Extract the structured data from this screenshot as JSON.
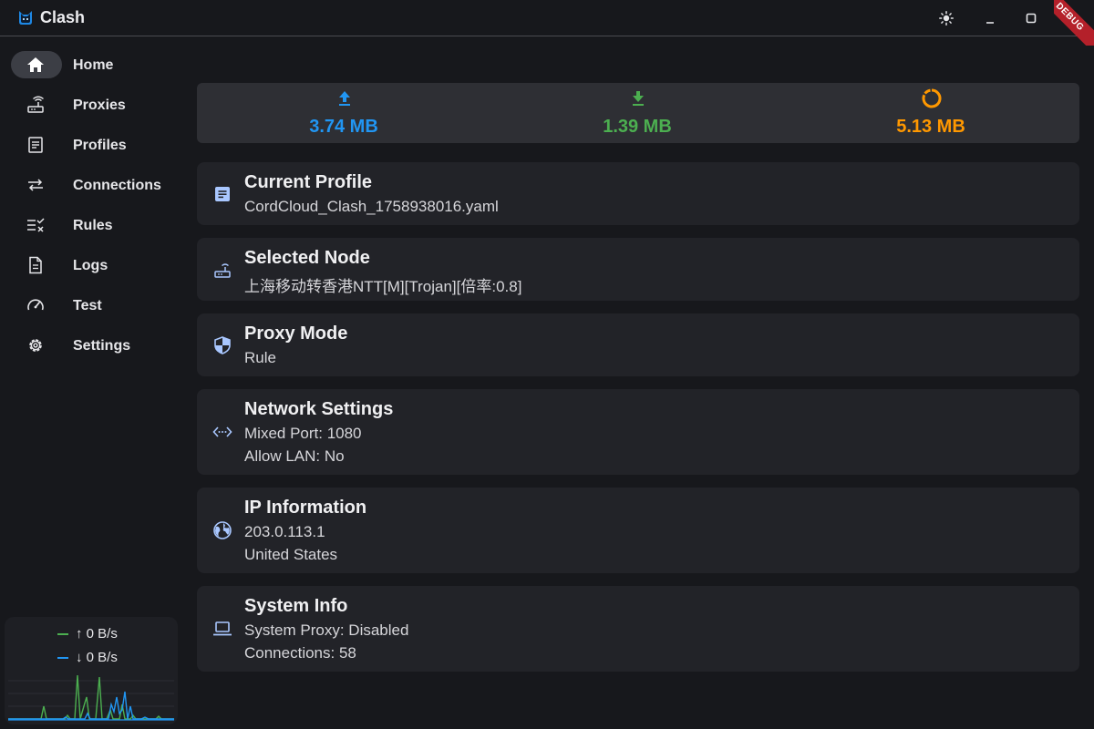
{
  "window": {
    "title": "Clash",
    "debug_label": "DEBUG"
  },
  "sidebar": {
    "items": [
      {
        "label": "Home",
        "icon": "home-icon",
        "active": true
      },
      {
        "label": "Proxies",
        "icon": "router-icon"
      },
      {
        "label": "Profiles",
        "icon": "document-icon"
      },
      {
        "label": "Connections",
        "icon": "swap-arrows-icon"
      },
      {
        "label": "Rules",
        "icon": "rules-checklist-icon"
      },
      {
        "label": "Logs",
        "icon": "log-file-icon"
      },
      {
        "label": "Test",
        "icon": "speedometer-icon"
      },
      {
        "label": "Settings",
        "icon": "gear-icon"
      }
    ],
    "speed": {
      "up": "↑ 0 B/s",
      "down": "↓ 0 B/s",
      "up_color": "#4caf50",
      "down_color": "#2196f3"
    }
  },
  "traffic": {
    "upload": {
      "value": "3.74 MB",
      "color": "#2196f3",
      "icon": "upload-icon"
    },
    "download": {
      "value": "1.39 MB",
      "color": "#4caf50",
      "icon": "download-icon"
    },
    "total": {
      "value": "5.13 MB",
      "color": "#ff9800",
      "icon": "donut-icon"
    }
  },
  "cards": {
    "profile": {
      "title": "Current Profile",
      "line1": "CordCloud_Clash_1758938016.yaml"
    },
    "node": {
      "title": "Selected Node",
      "line1": "上海移动转香港NTT[M][Trojan][倍率:0.8]"
    },
    "mode": {
      "title": "Proxy Mode",
      "line1": "Rule"
    },
    "network": {
      "title": "Network Settings",
      "line1": "Mixed Port: 1080",
      "line2": "Allow LAN: No"
    },
    "ip": {
      "title": "IP Information",
      "line1": "203.0.113.1",
      "line2": "United States"
    },
    "system": {
      "title": "System Info",
      "line1": "System Proxy: Disabled",
      "line2": "Connections: 58"
    }
  },
  "colors": {
    "accent_icon": "#a9c7ff",
    "background": "#17181c"
  }
}
